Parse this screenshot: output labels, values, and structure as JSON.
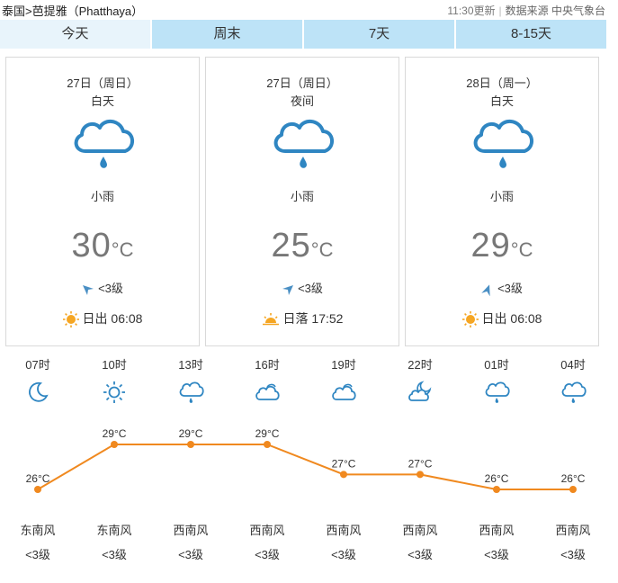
{
  "breadcrumb": {
    "country": "泰国",
    "separator": ">",
    "city": "芭提雅（Phatthaya）"
  },
  "meta": {
    "updated": "11:30更新",
    "source_label": "数据来源",
    "source": "中央气象台"
  },
  "tabs": [
    {
      "label": "今天",
      "active": true
    },
    {
      "label": "周末",
      "active": false
    },
    {
      "label": "7天",
      "active": false
    },
    {
      "label": "8-15天",
      "active": false
    }
  ],
  "cards": [
    {
      "date": "27日（周日）",
      "period": "白天",
      "icon": "rain-cloud-icon",
      "desc": "小雨",
      "temp": "30",
      "unit": "°C",
      "wind": "<3级",
      "sun_label": "日出",
      "sun_time": "06:08",
      "sun_icon": "sunrise-icon"
    },
    {
      "date": "27日（周日）",
      "period": "夜间",
      "icon": "rain-cloud-icon",
      "desc": "小雨",
      "temp": "25",
      "unit": "°C",
      "wind": "<3级",
      "sun_label": "日落",
      "sun_time": "17:52",
      "sun_icon": "sunset-icon"
    },
    {
      "date": "28日（周一）",
      "period": "白天",
      "icon": "rain-cloud-icon",
      "desc": "小雨",
      "temp": "29",
      "unit": "°C",
      "wind": "<3级",
      "sun_label": "日出",
      "sun_time": "06:08",
      "sun_icon": "sunrise-icon"
    }
  ],
  "hourly": [
    {
      "time": "07时",
      "icon": "moon-icon",
      "temp": "26°C",
      "wind_dir": "东南风",
      "wind_lvl": "<3级"
    },
    {
      "time": "10时",
      "icon": "sun-icon",
      "temp": "29°C",
      "wind_dir": "东南风",
      "wind_lvl": "<3级"
    },
    {
      "time": "13时",
      "icon": "rain-cloud-icon",
      "temp": "29°C",
      "wind_dir": "西南风",
      "wind_lvl": "<3级"
    },
    {
      "time": "16时",
      "icon": "cloudy-icon",
      "temp": "29°C",
      "wind_dir": "西南风",
      "wind_lvl": "<3级"
    },
    {
      "time": "19时",
      "icon": "cloudy-icon",
      "temp": "27°C",
      "wind_dir": "西南风",
      "wind_lvl": "<3级"
    },
    {
      "time": "22时",
      "icon": "partly-cloudy-night-icon",
      "temp": "27°C",
      "wind_dir": "西南风",
      "wind_lvl": "<3级"
    },
    {
      "time": "01时",
      "icon": "rain-cloud-icon",
      "temp": "26°C",
      "wind_dir": "西南风",
      "wind_lvl": "<3级"
    },
    {
      "time": "04时",
      "icon": "rain-cloud-icon",
      "temp": "26°C",
      "wind_dir": "西南风",
      "wind_lvl": "<3级"
    }
  ],
  "chart_data": {
    "type": "line",
    "categories": [
      "07时",
      "10时",
      "13时",
      "16时",
      "19时",
      "22时",
      "01时",
      "04时"
    ],
    "series": [
      {
        "values": [
          26,
          29,
          29,
          29,
          27,
          27,
          26,
          26
        ]
      }
    ],
    "labels": [
      "26°C",
      "29°C",
      "29°C",
      "29°C",
      "27°C",
      "27°C",
      "26°C",
      "26°C"
    ],
    "line_color": "#f0891f",
    "grid": false
  },
  "colors": {
    "icon_blue": "#2f86c2",
    "sun_orange": "#f5a623",
    "tab_bg": "#bde3f7",
    "tab_active_bg": "#e8f4fb"
  }
}
